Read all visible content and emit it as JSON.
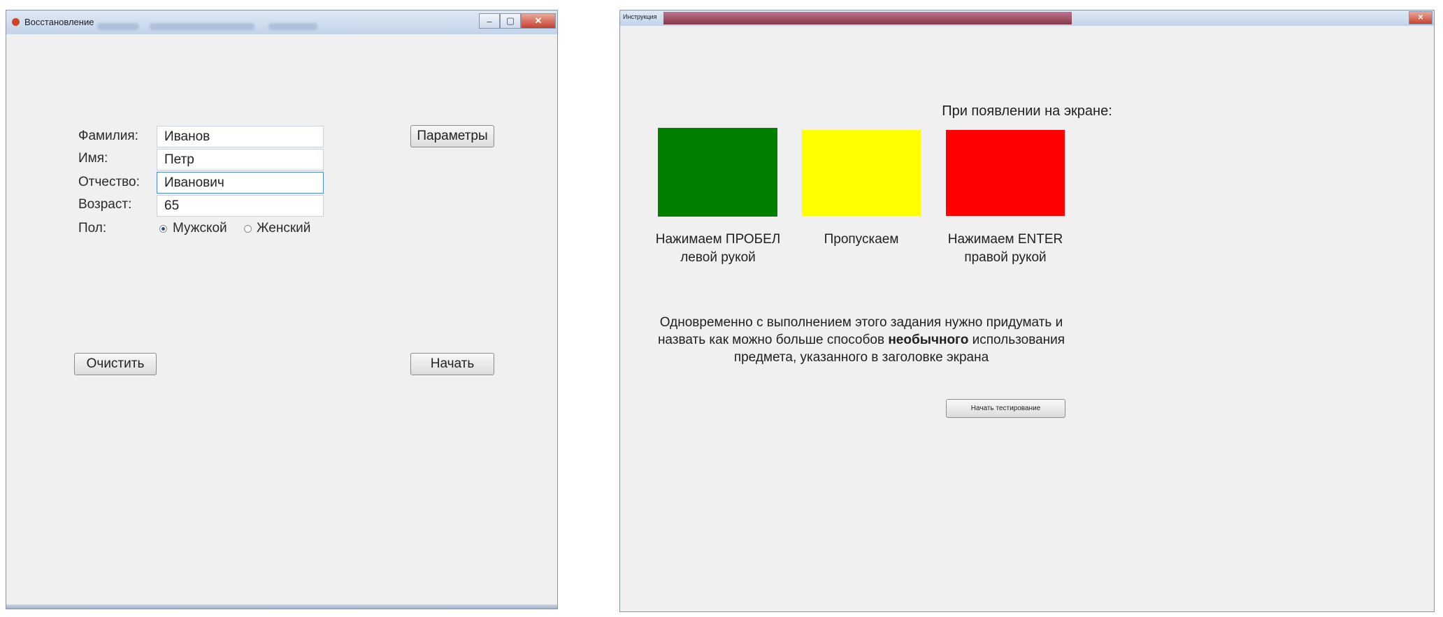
{
  "left_window": {
    "title": "Восстановление",
    "form": {
      "surname_label": "Фамилия:",
      "surname_value": "Иванов",
      "name_label": "Имя:",
      "name_value": "Петр",
      "patronymic_label": "Отчество:",
      "patronymic_value": "Иванович",
      "age_label": "Возраст:",
      "age_value": "65",
      "gender_label": "Пол:",
      "gender_options": [
        "Мужской",
        "Женский"
      ],
      "gender_selected": "Мужской"
    },
    "params_button": "Параметры",
    "clear_button": "Очистить",
    "start_button": "Начать"
  },
  "right_window": {
    "title": "Инструкция",
    "heading": "При появлении на экране:",
    "cards": [
      {
        "color": "#008000",
        "caption_line1": "Нажимаем ПРОБЕЛ",
        "caption_line2": "левой рукой"
      },
      {
        "color": "#ffff00",
        "caption_line1": "Пропускаем",
        "caption_line2": ""
      },
      {
        "color": "#ff0000",
        "caption_line1": "Нажимаем ENTER",
        "caption_line2": "правой рукой"
      }
    ],
    "instruction_line1": "Одновременно с выполнением этого задания нужно придумать и",
    "instruction_line2_before": "назвать как можно больше способов ",
    "instruction_line2_bold": "необычного",
    "instruction_line2_after": " использования",
    "instruction_line3": "предмета, указанного в заголовке экрана",
    "start_test_button": "Начать тестирование"
  }
}
